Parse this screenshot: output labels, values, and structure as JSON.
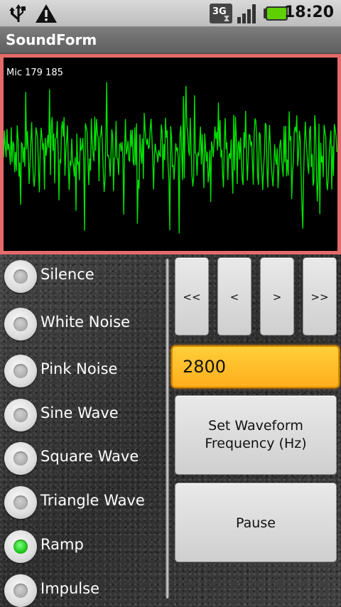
{
  "status_bar": {
    "time": "18:20",
    "icons": [
      "usb-icon",
      "warning-icon",
      "3g-icon",
      "signal-icon",
      "battery-icon"
    ],
    "network_label": "3G"
  },
  "app": {
    "title": "SoundForm"
  },
  "scope": {
    "label": "Mic 179 185",
    "border_color": "#e56a6a",
    "wave_color": "#00e000"
  },
  "waveforms": {
    "items": [
      {
        "label": "Silence",
        "selected": false
      },
      {
        "label": "White Noise",
        "selected": false
      },
      {
        "label": "Pink Noise",
        "selected": false
      },
      {
        "label": "Sine Wave",
        "selected": false
      },
      {
        "label": "Square Wave",
        "selected": false
      },
      {
        "label": "Triangle Wave",
        "selected": false
      },
      {
        "label": "Ramp",
        "selected": true
      },
      {
        "label": "Impulse",
        "selected": false
      }
    ]
  },
  "controls": {
    "first_label": "<<",
    "prev_label": "<",
    "next_label": ">",
    "last_label": ">>",
    "frequency_value": "2800",
    "set_freq_line1": "Set Waveform",
    "set_freq_line2": "Frequency (Hz)",
    "pause_label": "Pause"
  }
}
